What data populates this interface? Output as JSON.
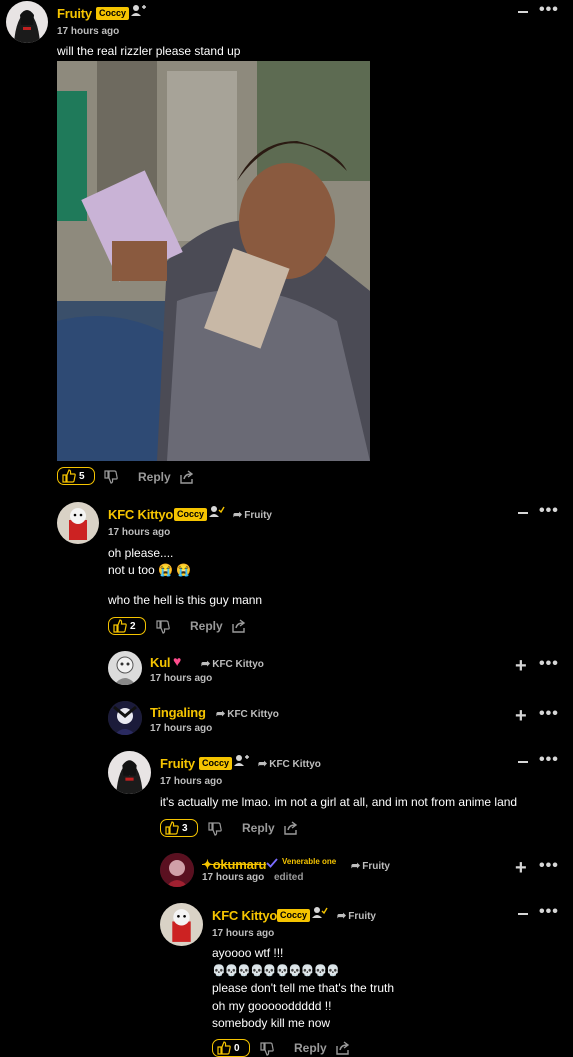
{
  "comments": [
    {
      "author": "Fruity",
      "badge": "Coccy",
      "time": "17 hours ago",
      "text": "will the real rizzler please stand up",
      "likes": "5",
      "reply_label": "Reply"
    },
    {
      "author": "KFC Kittyo",
      "badge": "Coccy",
      "reply_to": "Fruity",
      "time": "17 hours ago",
      "lines": [
        "oh please....",
        "not u too 😭 😭",
        "who the hell is this guy mann"
      ],
      "likes": "2",
      "reply_label": "Reply"
    },
    {
      "author": "Kul",
      "heart": "♥",
      "reply_to": "KFC Kittyo",
      "time": "17 hours ago"
    },
    {
      "author": "Tingaling",
      "reply_to": "KFC Kittyo",
      "time": "17 hours ago"
    },
    {
      "author": "Fruity",
      "badge": "Coccy",
      "reply_to": "KFC Kittyo",
      "time": "17 hours ago",
      "text": "it's actually me lmao. im not a girl at all, and im not from anime land",
      "likes": "3",
      "reply_label": "Reply"
    },
    {
      "author": "✦okumaru",
      "title": "Venerable one",
      "reply_to": "Fruity",
      "time": "17 hours ago",
      "edited": "edited"
    },
    {
      "author": "KFC Kittyo",
      "badge": "Coccy",
      "reply_to": "Fruity",
      "time": "17 hours ago",
      "lines": [
        "ayoooo wtf !!!",
        "💀💀💀💀💀💀💀💀💀💀",
        "please don't tell me that's the truth",
        "oh my goooooddddd !!",
        "somebody kill me now"
      ],
      "likes": "0",
      "reply_label": "Reply"
    }
  ],
  "colors": {
    "accent": "#f5c400",
    "background": "#000000",
    "muted": "#bdbdbd"
  },
  "icons": [
    "thumbs-up-icon",
    "thumbs-down-icon",
    "share-icon",
    "follow-user-icon",
    "collapse-icon",
    "expand-icon",
    "more-options-icon",
    "heart-icon",
    "verified-check-icon"
  ]
}
